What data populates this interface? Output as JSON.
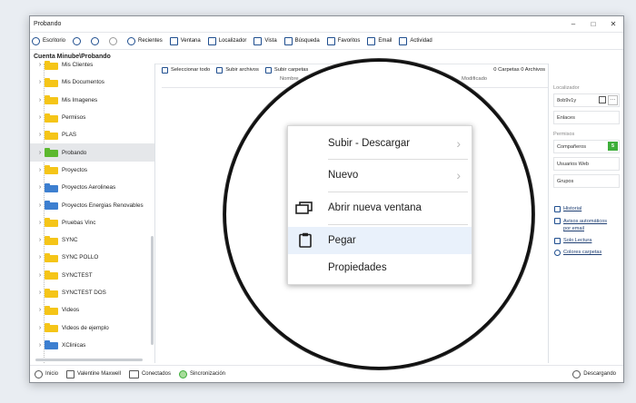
{
  "window": {
    "title": "Probando"
  },
  "toolbar": [
    {
      "label": "Escritorio",
      "icon": "desktop-icon"
    },
    {
      "label": "",
      "icon": "back-icon"
    },
    {
      "label": "",
      "icon": "up-icon"
    },
    {
      "label": "",
      "icon": "forward-icon"
    },
    {
      "label": "Recientes",
      "icon": "recent-icon"
    },
    {
      "label": "Ventana",
      "icon": "window-icon"
    },
    {
      "label": "Localizador",
      "icon": "locator-icon"
    },
    {
      "label": "Vista",
      "icon": "view-icon"
    },
    {
      "label": "Búsqueda",
      "icon": "search-icon"
    },
    {
      "label": "Favoritos",
      "icon": "favorites-icon"
    },
    {
      "label": "Email",
      "icon": "email-icon"
    },
    {
      "label": "Actividad",
      "icon": "activity-icon"
    }
  ],
  "breadcrumb": "Cuenta Minube\\Probando",
  "tree": [
    {
      "label": "Mis Clientes",
      "color": "yellow"
    },
    {
      "label": "Mis Documentos",
      "color": "yellow"
    },
    {
      "label": "Mis Imagenes",
      "color": "yellow"
    },
    {
      "label": "Permisos",
      "color": "yellow"
    },
    {
      "label": "PLAS",
      "color": "yellow"
    },
    {
      "label": "Probando",
      "color": "green",
      "selected": true
    },
    {
      "label": "Proyectos",
      "color": "yellow"
    },
    {
      "label": "Proyectos Aerolineas",
      "color": "blue"
    },
    {
      "label": "Proyectos Energias Renovables",
      "color": "blue"
    },
    {
      "label": "Pruebas Vinc",
      "color": "yellow"
    },
    {
      "label": "SYNC",
      "color": "yellow"
    },
    {
      "label": "SYNC POLLO",
      "color": "yellow"
    },
    {
      "label": "SYNCTEST",
      "color": "yellow"
    },
    {
      "label": "SYNCTEST  DOS",
      "color": "yellow"
    },
    {
      "label": "Videos",
      "color": "yellow"
    },
    {
      "label": "Videos de ejemplo",
      "color": "yellow"
    },
    {
      "label": "XClinicas",
      "color": "blue"
    }
  ],
  "main_toolbar": {
    "select_all": "Seleccionar todo",
    "upload_files": "Subir archivos",
    "upload_folders": "Subir carpetas",
    "counts": "0 Carpetas  0 Archivos"
  },
  "columns": {
    "name": "Nombre",
    "modified": "Modificado"
  },
  "right_panel": {
    "locator_label": "Localizador",
    "locator_value": "8ob9v1y",
    "links_label": "Enlaces",
    "permissions_label": "Permisos",
    "companions": "Compañeros",
    "companions_count": "5",
    "web_users": "Usuarios Web",
    "groups": "Grupos",
    "history": "Historial",
    "auto_notices": "Avisos automáticos por email",
    "read_only": "Solo Lectura",
    "folder_colors": "Colores carpetas"
  },
  "status": {
    "home": "Inicio",
    "user": "Valentine Maxwell",
    "connected": "Conectados",
    "sync": "Sincronización",
    "downloading": "Descargando"
  },
  "context_menu": [
    {
      "label": "Subir - Descargar",
      "submenu": true
    },
    {
      "label": "Nuevo",
      "submenu": true
    },
    {
      "label": "Abrir nueva ventana",
      "icon": "new-window-icon"
    },
    {
      "label": "Pegar",
      "icon": "paste-icon",
      "highlighted": true
    },
    {
      "label": "Propiedades"
    }
  ],
  "colors": {
    "folder_yellow": "#f5c518",
    "folder_green": "#5cb82e",
    "folder_blue": "#3d7fd0",
    "accent": "#1f4e8f",
    "badge_green": "#3dae3a"
  }
}
